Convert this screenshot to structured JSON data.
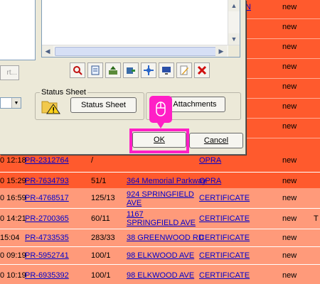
{
  "records": {
    "right_column": [
      {
        "status": "new",
        "link": "N"
      },
      {
        "status": "new"
      },
      {
        "status": "new"
      },
      {
        "status": "new"
      },
      {
        "status": "new"
      },
      {
        "status": "new"
      },
      {
        "status": "new"
      }
    ],
    "rows": [
      {
        "time": "0 12:18",
        "prn": "PR-2312764",
        "book": "/",
        "addr": "",
        "type": "OPRA",
        "status": "new",
        "extra": "",
        "style": "dark"
      },
      {
        "time": "0 15:29",
        "prn": "PR-7634793",
        "book": "51/1",
        "addr": "364 Memorial Parkway",
        "type": "OPRA",
        "status": "new",
        "extra": "",
        "style": "dark"
      },
      {
        "time": "0 16:59",
        "prn": "PR-4768517",
        "book": "125/13",
        "addr": "924 SPRINGFIELD AVE",
        "type": "CERTIFICATE",
        "status": "new",
        "extra": "",
        "style": "light"
      },
      {
        "time": "0 14:21",
        "prn": "PR-2700365",
        "book": "60/11",
        "addr": "1167 SPRINGFIELD AVE",
        "type": "CERTIFICATE",
        "status": "new",
        "extra": "T",
        "style": "light"
      },
      {
        "time": "15:04",
        "prn": "PR-4733535",
        "book": "283/33",
        "addr": "38 GREENWOOD RD",
        "type": "CERTIFICATE",
        "status": "new",
        "extra": "",
        "style": "light"
      },
      {
        "time": "0 09:19",
        "prn": "PR-5952741",
        "book": "100/1",
        "addr": "98 ELKWOOD AVE",
        "type": "CERTIFICATE",
        "status": "new",
        "extra": "",
        "style": "light"
      },
      {
        "time": "0 10:19",
        "prn": "PR-6935392",
        "book": "100/1",
        "addr": "98 ELKWOOD AVE",
        "type": "CERTIFICATE",
        "status": "new",
        "extra": "",
        "style": "light"
      }
    ]
  },
  "dialog": {
    "left_button_label": "rt...",
    "toolbar_icons": [
      "search-icon",
      "document-icon",
      "export-icon",
      "move-icon",
      "settings-icon",
      "monitor-icon",
      "edit-icon",
      "delete-icon"
    ],
    "status_sheet": {
      "group_label": "Status Sheet",
      "button_label": "Status Sheet"
    },
    "attachments_label": "Attachments",
    "ok_label": "OK",
    "cancel_label": "Cancel"
  },
  "highlight_color": "#ff1fc6"
}
